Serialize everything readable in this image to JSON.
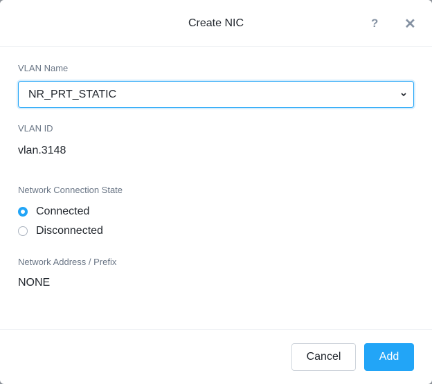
{
  "dialog": {
    "title": "Create NIC",
    "help_label": "?",
    "close_label": "✕"
  },
  "form": {
    "vlan_name": {
      "label": "VLAN Name",
      "value": "NR_PRT_STATIC"
    },
    "vlan_id": {
      "label": "VLAN ID",
      "value": "vlan.3148"
    },
    "connection_state": {
      "label": "Network Connection State",
      "options": [
        {
          "label": "Connected",
          "selected": true
        },
        {
          "label": "Disconnected",
          "selected": false
        }
      ]
    },
    "network_address": {
      "label": "Network Address / Prefix",
      "value": "NONE"
    }
  },
  "footer": {
    "cancel_label": "Cancel",
    "add_label": "Add"
  },
  "colors": {
    "accent": "#22a5f7"
  }
}
